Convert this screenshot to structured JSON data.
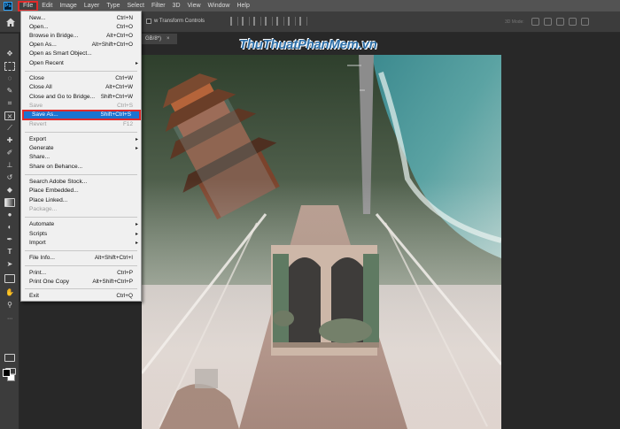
{
  "app": {
    "logo_text": "Ps",
    "document_tab": "GB/8*)",
    "tab_close": "×"
  },
  "menubar": {
    "items": [
      "File",
      "Edit",
      "Image",
      "Layer",
      "Type",
      "Select",
      "Filter",
      "3D",
      "View",
      "Window",
      "Help"
    ]
  },
  "options_bar": {
    "transform_label": "w Transform Controls",
    "mode_3d": "3D Mode:"
  },
  "watermark": "ThuThuatPhanMem.vn",
  "file_menu": {
    "items": [
      {
        "label": "New...",
        "shortcut": "Ctrl+N"
      },
      {
        "label": "Open...",
        "shortcut": "Ctrl+O"
      },
      {
        "label": "Browse in Bridge...",
        "shortcut": "Alt+Ctrl+O"
      },
      {
        "label": "Open As...",
        "shortcut": "Alt+Shift+Ctrl+O"
      },
      {
        "label": "Open as Smart Object...",
        "shortcut": ""
      },
      {
        "label": "Open Recent",
        "shortcut": "",
        "submenu": "▸"
      },
      {
        "label": "Close",
        "shortcut": "Ctrl+W"
      },
      {
        "label": "Close All",
        "shortcut": "Alt+Ctrl+W"
      },
      {
        "label": "Close and Go to Bridge...",
        "shortcut": "Shift+Ctrl+W"
      },
      {
        "label": "Save",
        "shortcut": "Ctrl+S",
        "disabled": true
      },
      {
        "label": "Save As...",
        "shortcut": "Shift+Ctrl+S",
        "highlighted": true
      },
      {
        "label": "Revert",
        "shortcut": "F12",
        "disabled": true
      },
      {
        "label": "Export",
        "shortcut": "",
        "submenu": "▸"
      },
      {
        "label": "Generate",
        "shortcut": "",
        "submenu": "▸"
      },
      {
        "label": "Share...",
        "shortcut": ""
      },
      {
        "label": "Share on Behance...",
        "shortcut": ""
      },
      {
        "label": "Search Adobe Stock...",
        "shortcut": ""
      },
      {
        "label": "Place Embedded...",
        "shortcut": ""
      },
      {
        "label": "Place Linked...",
        "shortcut": ""
      },
      {
        "label": "Package...",
        "shortcut": "",
        "disabled": true
      },
      {
        "label": "Automate",
        "shortcut": "",
        "submenu": "▸"
      },
      {
        "label": "Scripts",
        "shortcut": "",
        "submenu": "▸"
      },
      {
        "label": "Import",
        "shortcut": "",
        "submenu": "▸"
      },
      {
        "label": "File Info...",
        "shortcut": "Alt+Shift+Ctrl+I"
      },
      {
        "label": "Print...",
        "shortcut": "Ctrl+P"
      },
      {
        "label": "Print One Copy",
        "shortcut": "Alt+Shift+Ctrl+P"
      },
      {
        "label": "Exit",
        "shortcut": "Ctrl+Q"
      }
    ]
  },
  "toolbar": {
    "tools": [
      "move-tool",
      "marquee-tool",
      "lasso-tool",
      "quick-selection-tool",
      "crop-tool",
      "frame-tool",
      "eyedropper-tool",
      "healing-brush-tool",
      "brush-tool",
      "clone-stamp-tool",
      "history-brush-tool",
      "eraser-tool",
      "gradient-tool",
      "blur-tool",
      "dodge-tool",
      "pen-tool",
      "type-tool",
      "path-selection-tool",
      "rectangle-tool",
      "hand-tool",
      "zoom-tool"
    ],
    "type_glyph": "T"
  },
  "colors": {
    "highlight": "#1b73d0",
    "callout_border": "#e02b2b",
    "watermark": "#2d6fa8"
  }
}
